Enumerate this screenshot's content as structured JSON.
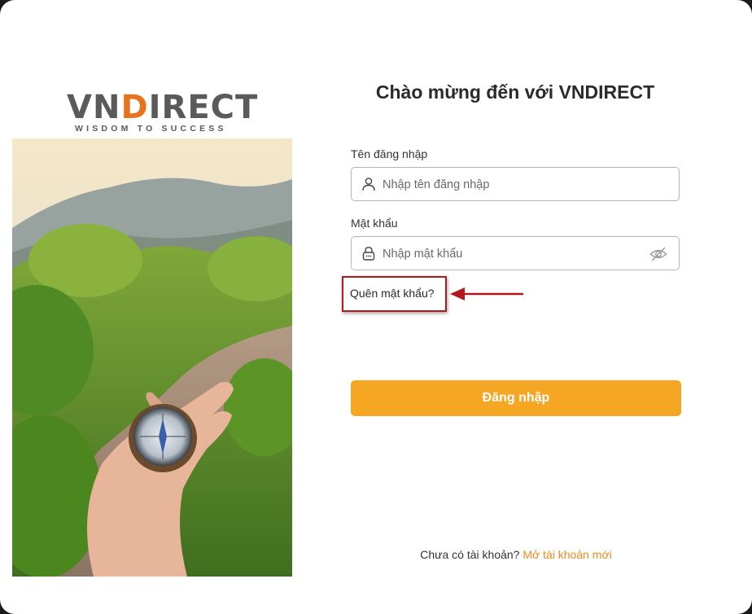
{
  "brand": {
    "logo_text_pre": "VN",
    "logo_text_d": "D",
    "logo_text_post": "IRECT",
    "tagline": "WISDOM TO SUCCESS"
  },
  "hero": {
    "icon": "compass-in-hand-landscape-photo"
  },
  "form": {
    "title": "Chào mừng đến với VNDIRECT",
    "username_label": "Tên đăng nhập",
    "username_placeholder": "Nhập tên đăng nhập",
    "username_icon": "user-icon",
    "password_label": "Mật khẩu",
    "password_placeholder": "Nhập mật khẩu",
    "password_icon": "lock-icon",
    "toggle_icon": "eye-off-icon",
    "forgot_password": "Quên mật khẩu?",
    "login_button": "Đăng nhập",
    "signup_prompt": "Chưa có tài khoản?",
    "signup_link": "Mở tài khoản mới"
  },
  "colors": {
    "accent": "#f5a623",
    "link": "#f08a1c",
    "highlight": "#b3181e",
    "logo_gray": "#5a5a5a",
    "logo_orange": "#e8731e"
  }
}
